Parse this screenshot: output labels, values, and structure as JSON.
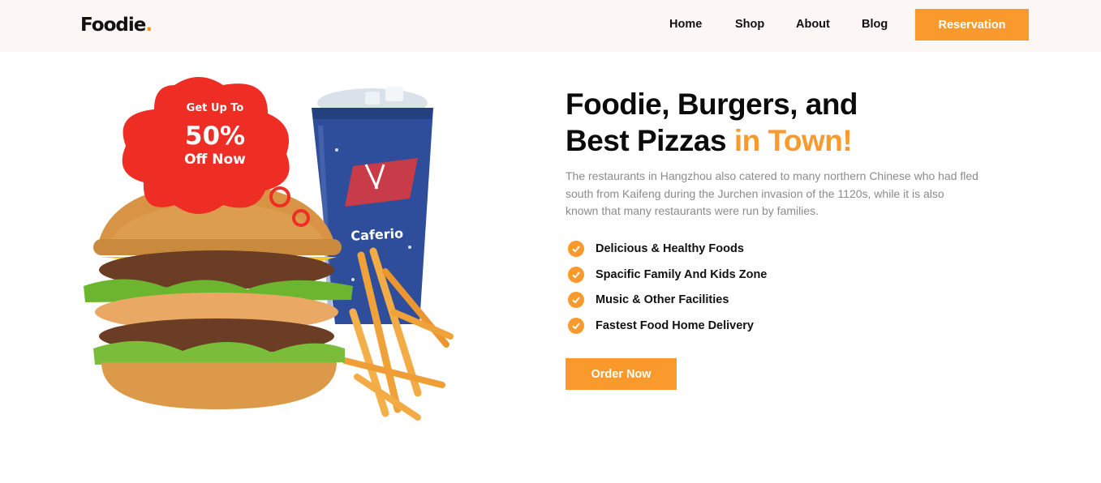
{
  "header": {
    "logo_text": "Foodie",
    "logo_dot": ".",
    "nav": [
      {
        "label": "Home"
      },
      {
        "label": "Shop"
      },
      {
        "label": "About"
      },
      {
        "label": "Blog"
      }
    ],
    "reservation_label": "Reservation"
  },
  "promo": {
    "line1": "Get Up To",
    "line2": "50%",
    "line3": "Off Now",
    "cup_brand": "Caferio"
  },
  "hero": {
    "title_line1": "Foodie, Burgers, and",
    "title_line2_plain": "Best Pizzas ",
    "title_line2_accent": "in Town!",
    "description": "The restaurants in Hangzhou also catered to many northern Chinese who had fled south from Kaifeng during the Jurchen invasion of the 1120s, while it is also known that many restaurants were run by families.",
    "features": [
      {
        "label": "Delicious & Healthy Foods",
        "icon": "check-circle-icon"
      },
      {
        "label": "Spacific Family And Kids Zone",
        "icon": "check-circle-icon"
      },
      {
        "label": "Music & Other Facilities",
        "icon": "check-circle-icon"
      },
      {
        "label": "Fastest Food Home Delivery",
        "icon": "check-circle-icon"
      }
    ],
    "cta_label": "Order Now"
  },
  "colors": {
    "accent": "#fb9a2c",
    "header_bg": "#fcf6f4",
    "promo_red": "#ee2e24",
    "cup_blue": "#2e4d9a"
  }
}
